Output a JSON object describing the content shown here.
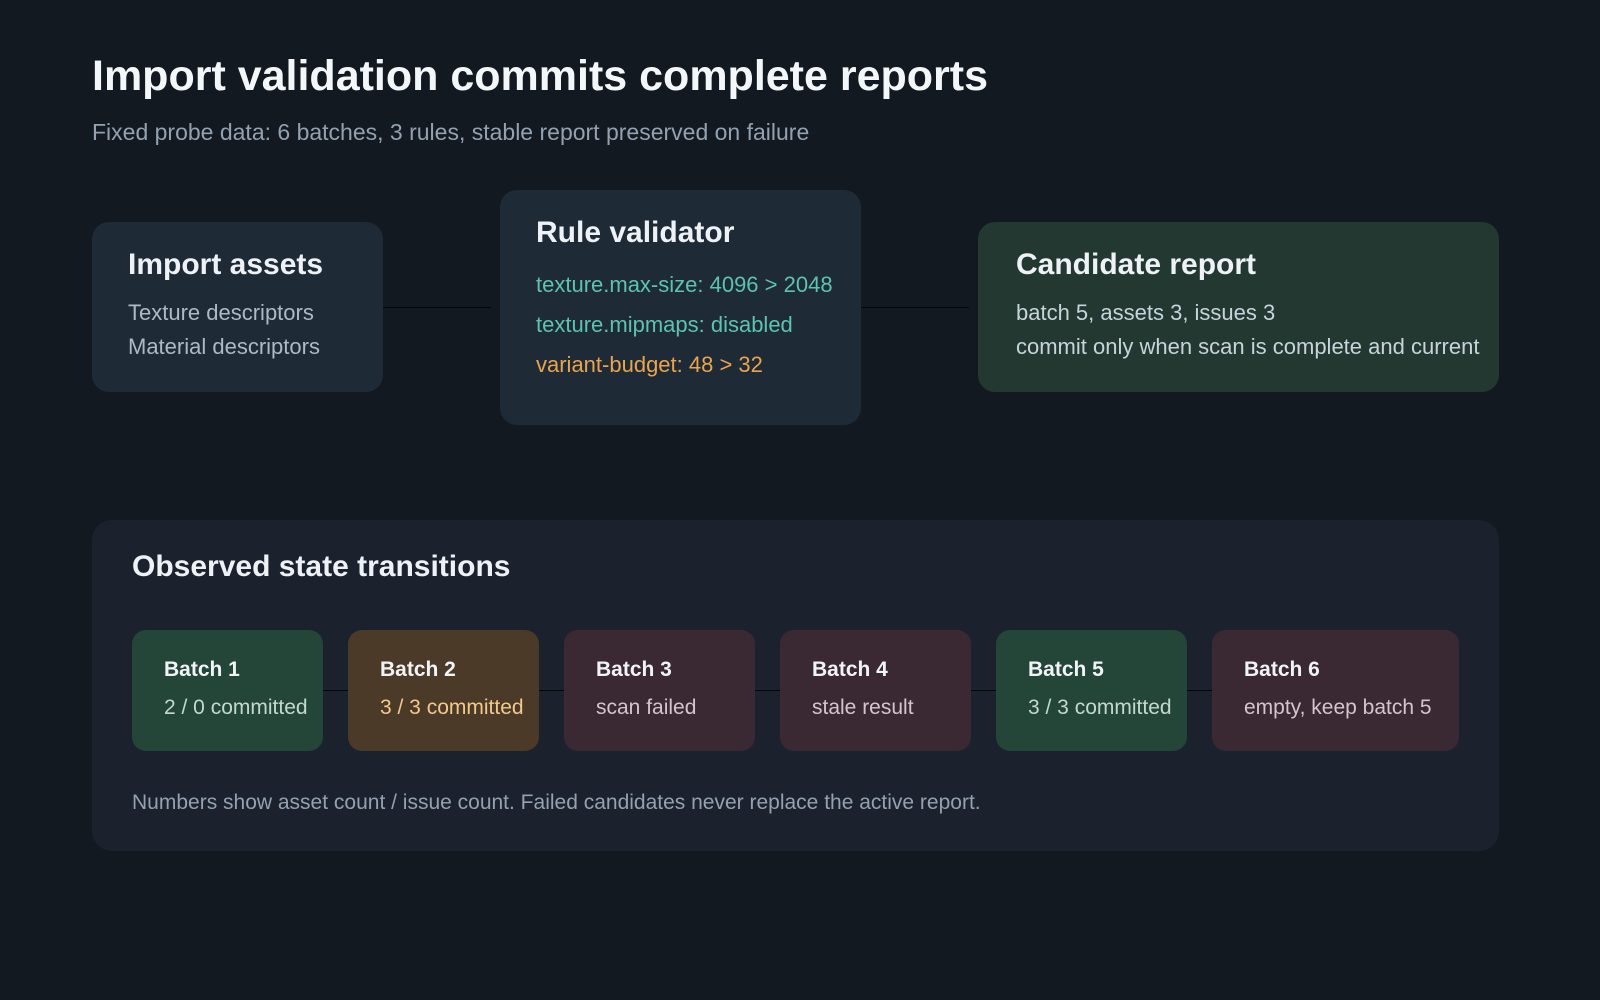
{
  "title": "Import validation commits complete reports",
  "subtitle": "Fixed probe data: 6 batches, 3 rules, stable report preserved on failure",
  "flow": {
    "import": {
      "heading": "Import assets",
      "lines": [
        "Texture descriptors",
        "Material descriptors"
      ]
    },
    "validator": {
      "heading": "Rule validator",
      "rules": [
        {
          "text": "texture.max-size: 4096 > 2048",
          "color": "#5cc3b0"
        },
        {
          "text": "texture.mipmaps: disabled",
          "color": "#5cc3b0"
        },
        {
          "text": "variant-budget: 48 > 32",
          "color": "#e9a44f"
        }
      ]
    },
    "report": {
      "heading": "Candidate report",
      "lines": [
        "batch 5, assets 3, issues 3",
        "commit only when scan is complete and current"
      ]
    }
  },
  "transitions": {
    "heading": "Observed state transitions",
    "batches": [
      {
        "title": "Batch 1",
        "status": "2 / 0 committed",
        "bg": "#234638",
        "status_color": "#c5d8d0"
      },
      {
        "title": "Batch 2",
        "status": "3 / 3 committed",
        "bg": "#4b3a27",
        "status_color": "#f2c98f"
      },
      {
        "title": "Batch 3",
        "status": "scan failed",
        "bg": "#3a2932",
        "status_color": "#d8c3cb"
      },
      {
        "title": "Batch 4",
        "status": "stale result",
        "bg": "#3a2932",
        "status_color": "#d8c3cb"
      },
      {
        "title": "Batch 5",
        "status": "3 / 3 committed",
        "bg": "#234638",
        "status_color": "#c5d8d0"
      },
      {
        "title": "Batch 6",
        "status": "empty, keep batch 5",
        "bg": "#3a2932",
        "status_color": "#d8c3cb"
      }
    ],
    "note": "Numbers show asset count / issue count. Failed candidates never replace the active report."
  }
}
